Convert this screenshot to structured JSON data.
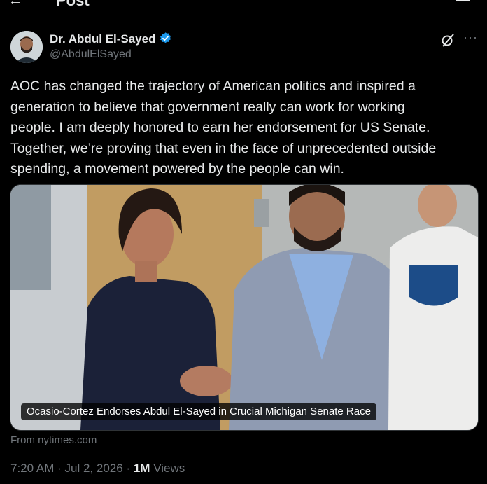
{
  "header": {
    "title": "Post",
    "back_icon": "back-arrow-icon",
    "right_icon": "reader-icon"
  },
  "author": {
    "name": "Dr. Abdul El-Sayed",
    "handle": "@AbdulElSayed",
    "verified_color": "#1d9bf0"
  },
  "post": {
    "text": "AOC has changed the trajectory of American politics and inspired a\ngeneration to believe that government really can work for working\npeople. I am deeply honored to earn her endorsement for US Senate.\nTogether, we’re proving that even in the face of unprecedented outside\nspending, a movement powered by the people can win."
  },
  "card": {
    "caption": "Ocasio-Cortez Endorses Abdul El-Sayed in Crucial Michigan Senate Race",
    "source": "From nytimes.com"
  },
  "meta": {
    "time": "7:20 AM",
    "date": "Jul 2, 2026",
    "separator": "·",
    "views_count": "1M",
    "views_label": "Views"
  }
}
